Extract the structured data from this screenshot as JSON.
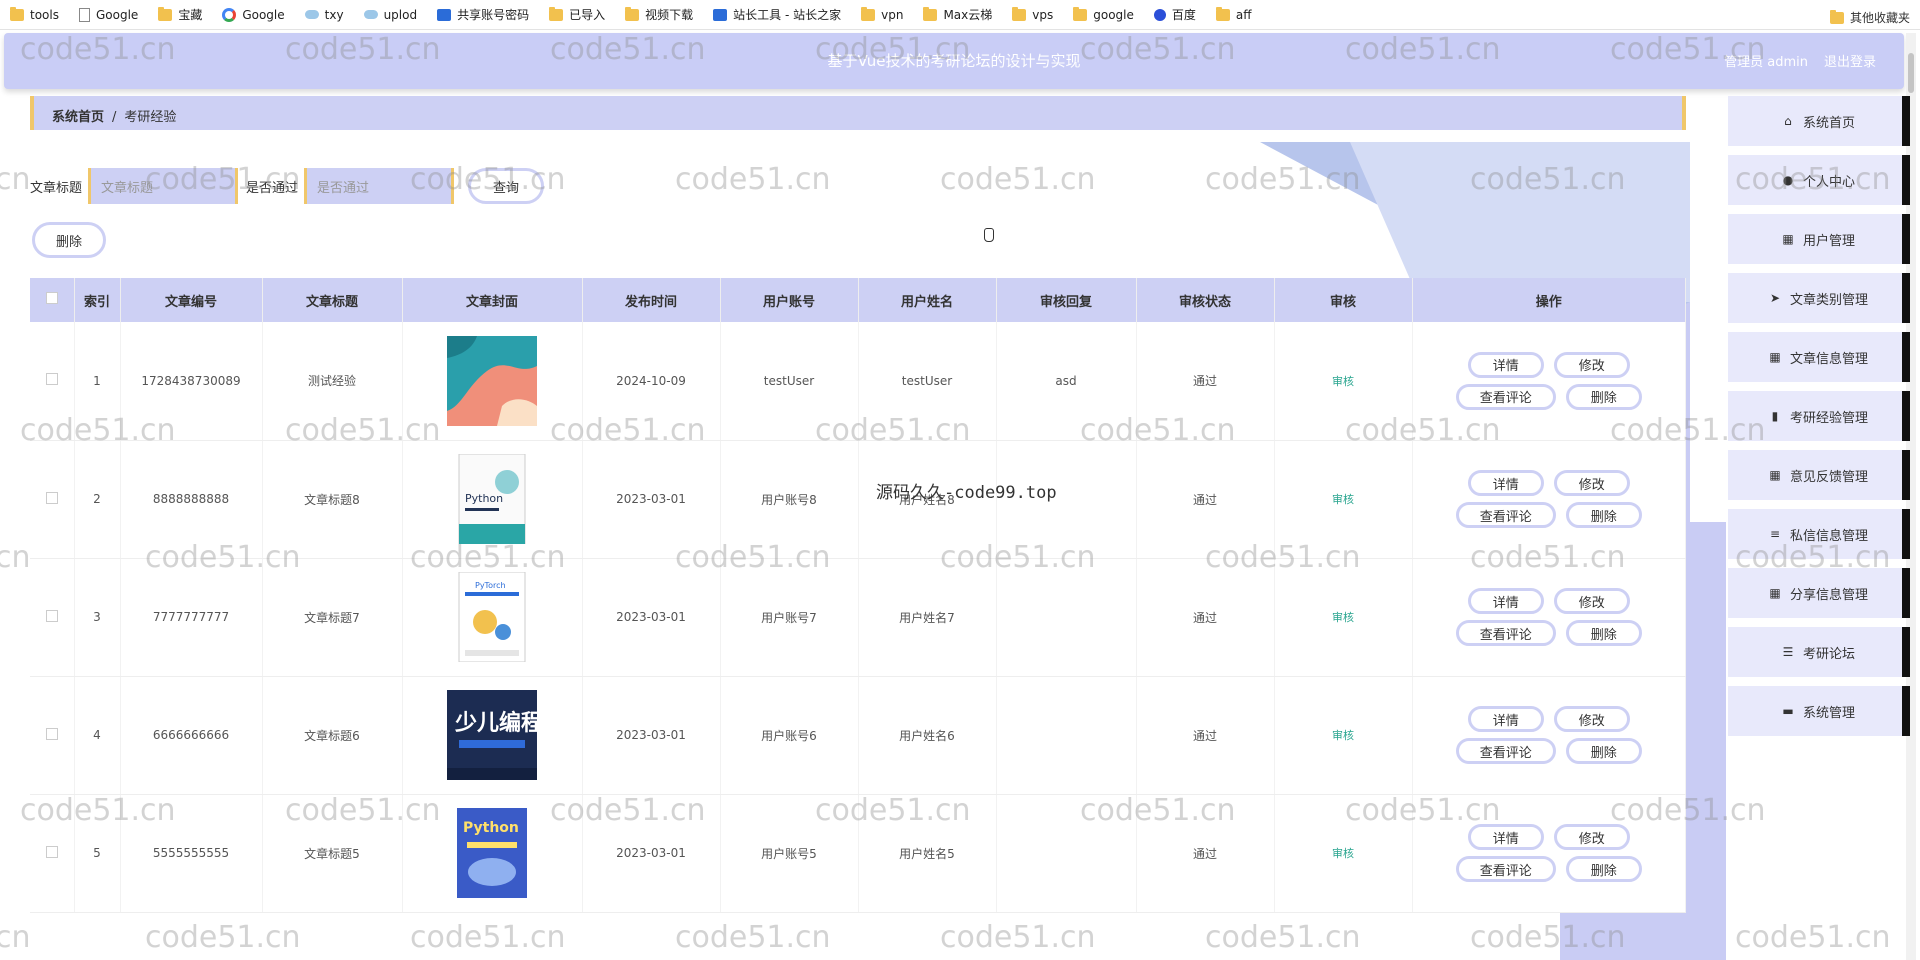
{
  "bookmarks": {
    "items": [
      {
        "label": "tools",
        "icon": "folder"
      },
      {
        "label": "Google",
        "icon": "page"
      },
      {
        "label": "宝藏",
        "icon": "folder"
      },
      {
        "label": "Google",
        "icon": "g"
      },
      {
        "label": "txy",
        "icon": "cloud"
      },
      {
        "label": "uplod",
        "icon": "cloud"
      },
      {
        "label": "共享账号密码",
        "icon": "blue"
      },
      {
        "label": "已导入",
        "icon": "folder"
      },
      {
        "label": "视频下载",
        "icon": "folder"
      },
      {
        "label": "站长工具 - 站长之家",
        "icon": "blue"
      },
      {
        "label": "vpn",
        "icon": "folder"
      },
      {
        "label": "Max云梯",
        "icon": "folder"
      },
      {
        "label": "vps",
        "icon": "folder"
      },
      {
        "label": "google",
        "icon": "folder"
      },
      {
        "label": "百度",
        "icon": "paw"
      },
      {
        "label": "aff",
        "icon": "folder"
      }
    ],
    "other": "其他收藏夹"
  },
  "header": {
    "title": "基于Vue技术的考研论坛的设计与实现",
    "user": "管理员 admin",
    "logout": "退出登录"
  },
  "breadcrumb": {
    "home": "系统首页",
    "sep": "/",
    "current": "考研经验"
  },
  "search": {
    "title_label": "文章标题",
    "title_placeholder": "文章标题",
    "pass_label": "是否通过",
    "pass_placeholder": "是否通过",
    "query_button": "查询",
    "delete_button": "删除"
  },
  "table": {
    "headers": [
      "",
      "索引",
      "文章编号",
      "文章标题",
      "文章封面",
      "发布时间",
      "用户账号",
      "用户姓名",
      "审核回复",
      "审核状态",
      "审核",
      "操作"
    ],
    "rows": [
      {
        "index": "1",
        "code": "1728438730089",
        "title": "测试经验",
        "cover": "abstract",
        "date": "2024-10-09",
        "account": "testUser",
        "name": "testUser",
        "reply": "asd",
        "status": "通过",
        "audit": "审核"
      },
      {
        "index": "2",
        "code": "8888888888",
        "title": "文章标题8",
        "cover": "python-book",
        "date": "2023-03-01",
        "account": "用户账号8",
        "name": "用户姓名8",
        "reply": "",
        "status": "通过",
        "audit": "审核"
      },
      {
        "index": "3",
        "code": "7777777777",
        "title": "文章标题7",
        "cover": "pytorch-book",
        "date": "2023-03-01",
        "account": "用户账号7",
        "name": "用户姓名7",
        "reply": "",
        "status": "通过",
        "audit": "审核"
      },
      {
        "index": "4",
        "code": "6666666666",
        "title": "文章标题6",
        "cover": "kids-coding-book",
        "date": "2023-03-01",
        "account": "用户账号6",
        "name": "用户姓名6",
        "reply": "",
        "status": "通过",
        "audit": "审核"
      },
      {
        "index": "5",
        "code": "5555555555",
        "title": "文章标题5",
        "cover": "python-blue-book",
        "date": "2023-03-01",
        "account": "用户账号5",
        "name": "用户姓名5",
        "reply": "",
        "status": "通过",
        "audit": "审核"
      }
    ],
    "ops": {
      "detail": "详情",
      "edit": "修改",
      "comments": "查看评论",
      "delete": "删除"
    }
  },
  "sidebar": {
    "items": [
      {
        "label": "系统首页",
        "icon": "home-icon"
      },
      {
        "label": "个人中心",
        "icon": "person-icon"
      },
      {
        "label": "用户管理",
        "icon": "grid-icon"
      },
      {
        "label": "文章类别管理",
        "icon": "send-icon"
      },
      {
        "label": "文章信息管理",
        "icon": "grid-icon"
      },
      {
        "label": "考研经验管理",
        "icon": "chart-icon"
      },
      {
        "label": "意见反馈管理",
        "icon": "grid-icon"
      },
      {
        "label": "私信信息管理",
        "icon": "sliders-icon"
      },
      {
        "label": "分享信息管理",
        "icon": "grid-icon"
      },
      {
        "label": "考研论坛",
        "icon": "list-icon"
      },
      {
        "label": "系统管理",
        "icon": "monitor-icon"
      }
    ]
  },
  "watermark": {
    "text": "code51.cn",
    "center_text": "源码久久-code99.top"
  },
  "colors": {
    "accent": "#cdd0f4",
    "border_accent": "#f0c76a",
    "audit_link": "#2aa58f"
  }
}
